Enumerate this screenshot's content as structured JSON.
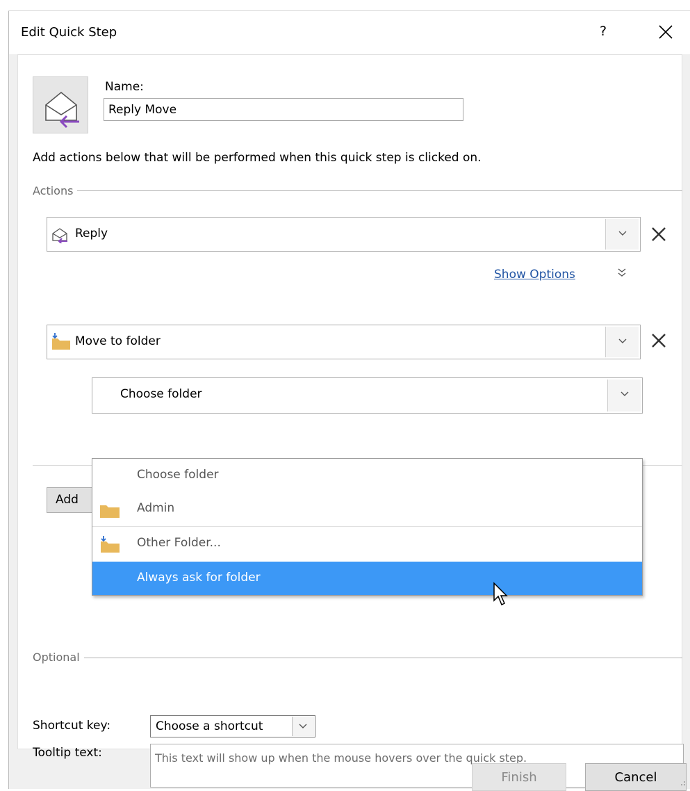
{
  "dialog": {
    "title": "Edit Quick Step",
    "help_label": "?"
  },
  "name": {
    "label": "Name:",
    "value": "Reply Move"
  },
  "instructions": "Add actions below that will be performed when this quick step is clicked on.",
  "actions_section": {
    "label": "Actions"
  },
  "actions": [
    {
      "label": "Reply",
      "icon": "reply-envelope-icon"
    },
    {
      "label": "Move to folder",
      "icon": "move-folder-icon"
    }
  ],
  "show_options": {
    "label": "Show Options",
    "chevrons": "≫"
  },
  "folder_select": {
    "value": "Choose folder",
    "options": [
      {
        "label": "Choose folder",
        "icon": ""
      },
      {
        "label": "Admin",
        "icon": "folder-icon"
      },
      {
        "label": "Other Folder...",
        "icon": "move-folder-icon"
      },
      {
        "label": "Always ask for folder",
        "icon": "",
        "highlighted": true
      }
    ]
  },
  "add_action": {
    "label": "Add"
  },
  "optional_section": {
    "label": "Optional",
    "shortcut_label": "Shortcut key:",
    "shortcut_value": "Choose a shortcut",
    "tooltip_label": "Tooltip text:",
    "tooltip_value": "This text will show up when the mouse hovers over the quick step."
  },
  "footer": {
    "finish_label": "Finish",
    "cancel_label": "Cancel"
  },
  "colors": {
    "highlight": "#3c98f6",
    "link": "#2255a4",
    "folder": "#e8b85a",
    "reply_arrow": "#8a4bbf"
  }
}
